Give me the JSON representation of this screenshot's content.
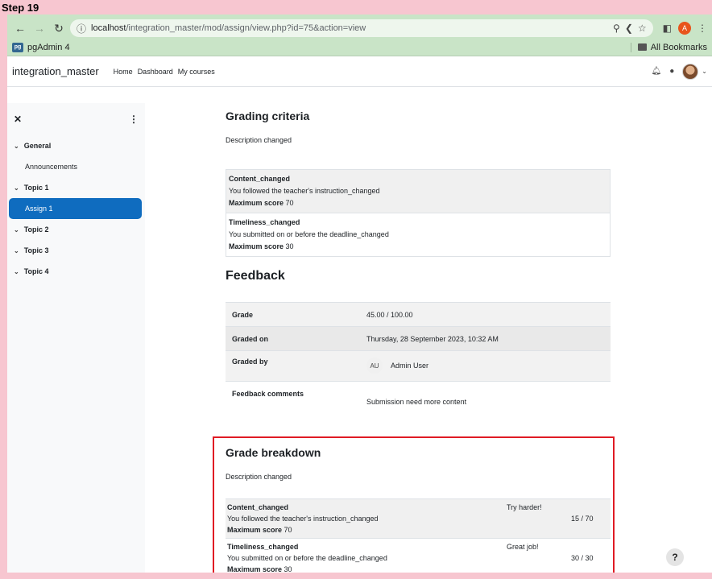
{
  "step": "Step 19",
  "browser": {
    "url_host": "localhost",
    "url_path": "/integration_master/mod/assign/view.php?id=75&action=view",
    "bookmark": "pgAdmin 4",
    "bookmark_icon_text": "pg",
    "all_bookmarks": "All Bookmarks",
    "profile_initial": "A",
    "profile_color": "#e8541c"
  },
  "navbar": {
    "site_name": "integration_master",
    "links": [
      "Home",
      "Dashboard",
      "My courses"
    ]
  },
  "drawer": {
    "items": [
      {
        "label": "General",
        "type": "section"
      },
      {
        "label": "Announcements",
        "type": "activity"
      },
      {
        "label": "Topic 1",
        "type": "section"
      },
      {
        "label": "Assign 1",
        "type": "activity",
        "active": true
      },
      {
        "label": "Topic 2",
        "type": "section"
      },
      {
        "label": "Topic 3",
        "type": "section"
      },
      {
        "label": "Topic 4",
        "type": "section"
      }
    ],
    "active_color": "#0f6cbf"
  },
  "grading_criteria": {
    "heading": "Grading criteria",
    "description": "Description changed",
    "criteria": [
      {
        "title": "Content_changed",
        "text": "You followed the teacher's instruction_changed",
        "max_label": "Maximum score",
        "max": "70"
      },
      {
        "title": "Timeliness_changed",
        "text": "You submitted on or before the deadline_changed",
        "max_label": "Maximum score",
        "max": "30"
      }
    ]
  },
  "feedback": {
    "heading": "Feedback",
    "grade_label": "Grade",
    "grade_value": "45.00 / 100.00",
    "graded_on_label": "Graded on",
    "graded_on_value": "Thursday, 28 September 2023, 10:32 AM",
    "graded_by_label": "Graded by",
    "grader_initials": "AU",
    "grader_name": "Admin User",
    "comments_label": "Feedback comments",
    "comments_value": "Submission need more content"
  },
  "breakdown": {
    "heading": "Grade breakdown",
    "description": "Description changed",
    "rows": [
      {
        "title": "Content_changed",
        "text": "You followed the teacher's instruction_changed",
        "max_label": "Maximum score",
        "max": "70",
        "remark": "Try harder!",
        "score": "15 / 70"
      },
      {
        "title": "Timeliness_changed",
        "text": "You submitted on or before the deadline_changed",
        "max_label": "Maximum score",
        "max": "30",
        "remark": "Great job!",
        "score": "30 / 30"
      }
    ],
    "highlight_color": "#e01b24"
  },
  "help": "?"
}
